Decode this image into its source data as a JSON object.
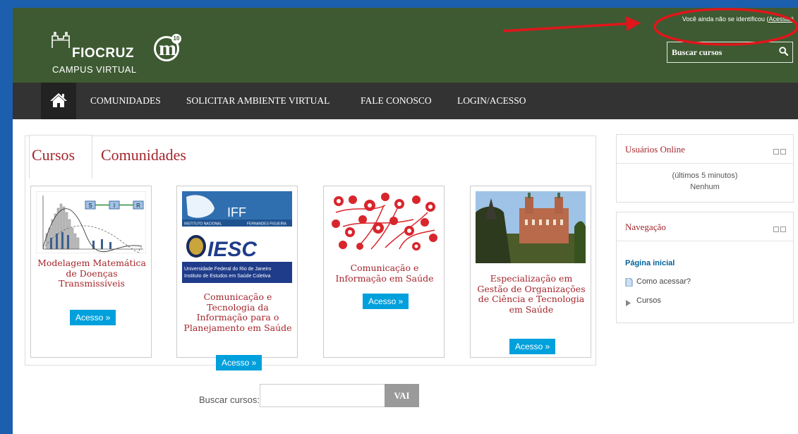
{
  "header": {
    "logo_name": "FIOCRUZ",
    "logo_sub": "CAMPUS VIRTUAL",
    "badge_letter": "m",
    "badge_number": "10",
    "login_status_text": "Você ainda não se identificou (",
    "login_link": "Acessar",
    "login_status_close": ")",
    "search_placeholder": "Buscar cursos",
    "bg_color": "#3e5a32"
  },
  "navbar": {
    "items": [
      {
        "label": "COMUNIDADES"
      },
      {
        "label": "SOLICITAR AMBIENTE VIRTUAL"
      },
      {
        "label": "FALE CONOSCO"
      },
      {
        "label": "LOGIN/ACESSO"
      }
    ]
  },
  "main": {
    "tabs": [
      {
        "label": "Cursos"
      },
      {
        "label": "Comunidades"
      }
    ],
    "courses": [
      {
        "title": "Modelagem Matemática de Doenças Transmissíveis",
        "button": "Acesso »"
      },
      {
        "title": "Comunicação e Tecnologia da Informação para o Planejamento em Saúde",
        "button": "Acesso »",
        "image_text_1": "IFF",
        "image_text_2": "INSTITUTO NACIONAL",
        "image_text_3": "FERNANDES FIGUEIRA",
        "image_text_4": "IESC",
        "image_text_5": "Universidade Federal do Rio de Janeiro",
        "image_text_6": "Instituto de Estudos em Saúde Coletiva"
      },
      {
        "title": "Comunicação e Informação em Saúde",
        "button": "Acesso »"
      },
      {
        "title": "Especialização em Gestão de Organizações de Ciência e Tecnologia em Saúde",
        "button": "Acesso »"
      }
    ],
    "course1_diagram_labels": [
      "S",
      "I",
      "R"
    ],
    "search_label": "Buscar cursos:",
    "search_button": "VAI"
  },
  "sidebar": {
    "online": {
      "title": "Usuários Online",
      "period": "(últimos 5 minutos)",
      "status": "Nenhum"
    },
    "navigation": {
      "title": "Navegação",
      "home": "Página inicial",
      "how_to": "Como acessar?",
      "courses": "Cursos"
    }
  },
  "colors": {
    "accent": "#a4262c",
    "button": "#00a0dc",
    "navbar": "#333333",
    "annotation": "#e0161b"
  }
}
